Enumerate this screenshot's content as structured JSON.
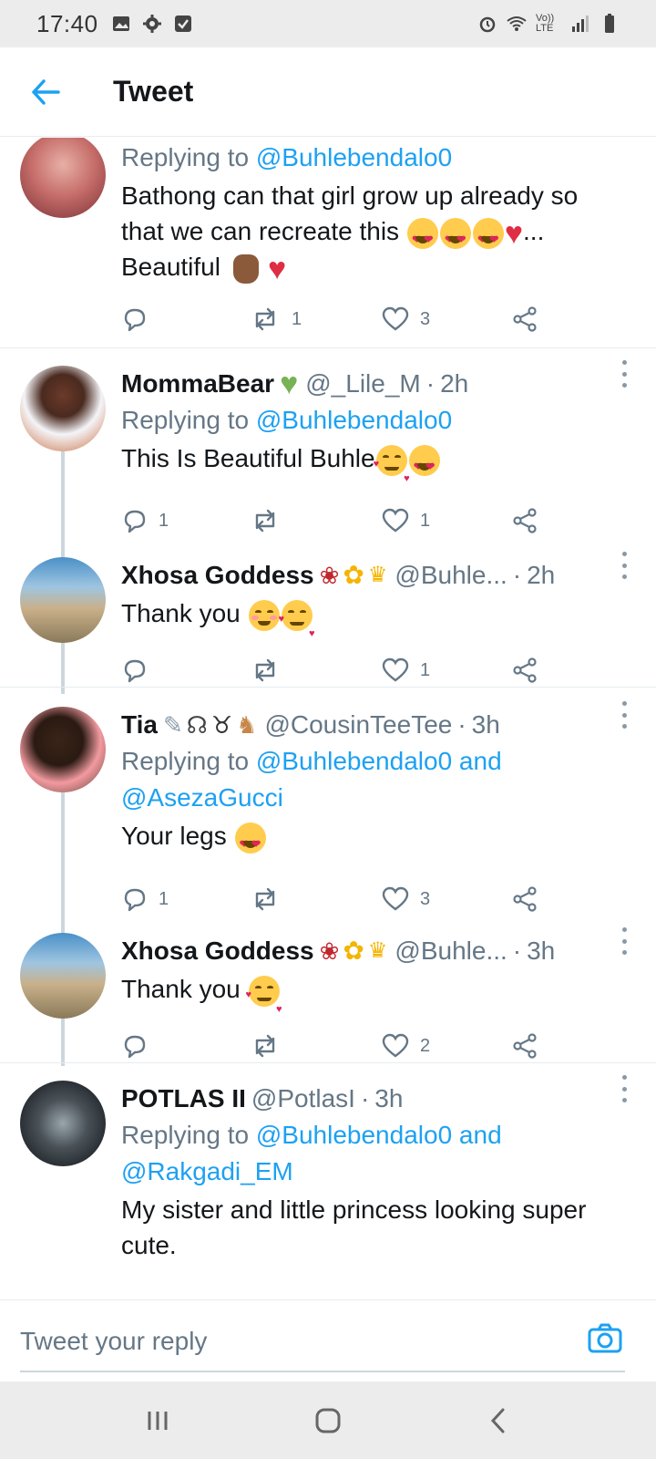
{
  "status_bar": {
    "time": "17:40",
    "network_label": "Vo)) LTE"
  },
  "header": {
    "title": "Tweet"
  },
  "tweets": [
    {
      "reply_prefix": "Replying to ",
      "reply_to": "@Buhlebendalo0",
      "text_line1": "Bathong can that girl grow up already so",
      "text_line2": "that we can recreate this",
      "text_line2_suffix": "...",
      "text_line3": "Beautiful",
      "replies": "",
      "retweets": "1",
      "likes": "3"
    },
    {
      "name": "MommaBear",
      "handle": "@_Lile_M",
      "sep": "·",
      "time": "2h",
      "reply_prefix": "Replying to ",
      "reply_to": "@Buhlebendalo0",
      "text": "This Is Beautiful Buhle",
      "replies": "1",
      "retweets": "",
      "likes": "1"
    },
    {
      "name": "Xhosa Goddess",
      "handle": "@Buhle...",
      "sep": "·",
      "time": "2h",
      "text": "Thank you",
      "replies": "",
      "retweets": "",
      "likes": "1"
    },
    {
      "name": "Tia",
      "handle": "@CousinTeeTee",
      "sep": "·",
      "time": "3h",
      "reply_prefix": "Replying to ",
      "reply_to": "@Buhlebendalo0 and",
      "reply_to_2": "@AsezaGucci",
      "text": "Your legs",
      "replies": "1",
      "retweets": "",
      "likes": "3"
    },
    {
      "name": "Xhosa Goddess",
      "handle": "@Buhle...",
      "sep": "·",
      "time": "3h",
      "text": "Thank you",
      "replies": "",
      "retweets": "",
      "likes": "2"
    },
    {
      "name": "POTLAS II",
      "handle": "@PotlasI",
      "sep": "·",
      "time": "3h",
      "reply_prefix": "Replying to ",
      "reply_to": "@Buhlebendalo0 and",
      "reply_to_2": "@Rakgadi_EM",
      "text_line1": "My sister and little princess looking super",
      "text_line2": "cute."
    }
  ],
  "compose": {
    "placeholder": "Tweet your reply"
  },
  "colors": {
    "accent": "#1da1f2",
    "text": "#14171a",
    "secondary": "#657786",
    "border": "#e6ecf0"
  }
}
